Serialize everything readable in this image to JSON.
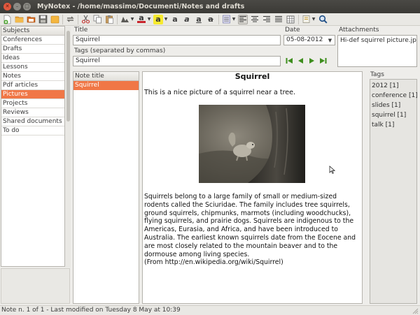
{
  "window": {
    "title": "MyNotex - /home/massimo/Documenti/Notes and drafts"
  },
  "toolbar": {
    "icons": [
      "new-note-icon",
      "new-subject-icon",
      "open-file-icon",
      "save-icon",
      "import-icon",
      "cut-icon",
      "copy-icon",
      "paste-icon",
      "undo-icon",
      "redo-icon",
      "insert-image-icon",
      "font-color-icon",
      "highlight-color-icon",
      "bold-icon",
      "italic-icon",
      "underline-icon",
      "strikethrough-icon",
      "list-icon",
      "align-left-icon",
      "align-center-icon",
      "align-right-icon",
      "justify-icon",
      "insert-table-icon",
      "note-type-icon",
      "search-icon"
    ],
    "font_color_glyph": "a",
    "highlight_glyph": "a",
    "bold_glyph": "a",
    "italic_glyph": "a",
    "underline_glyph": "a",
    "strike_glyph": "a",
    "font_color": "#c8252c",
    "highlight_color": "#f7ea2f"
  },
  "subjects": {
    "header": "Subjects",
    "items": [
      "Conferences",
      "Drafts",
      "Ideas",
      "Lessons",
      "Notes",
      "Pdf articles",
      "Pictures",
      "Projects",
      "Reviews",
      "Shared documents",
      "To do"
    ],
    "selected": "Pictures"
  },
  "note_fields": {
    "title_label": "Title",
    "title_value": "Squirrel",
    "tags_label": "Tags (separated by commas)",
    "tags_value": "Squirrel",
    "date_label": "Date",
    "date_value": "05-08-2012",
    "attachments_label": "Attachments",
    "attachments": [
      "Hi-def squirrel picture.jpg"
    ]
  },
  "note_list": {
    "header": "Note title",
    "items": [
      "Squirrel"
    ]
  },
  "editor": {
    "heading": "Squirrel",
    "intro": "This is a nice picture of a squirrel near a tree.",
    "body": "Squirrels belong to a large family of small or medium-sized rodents called the Sciuridae. The family includes tree squirrels, ground squirrels, chipmunks, marmots (including woodchucks), flying squirrels, and prairie dogs. Squirrels are indigenous to the Americas, Eurasia, and Africa, and have been introduced to Australia. The earliest known squirrels date from the Eocene and are most closely related to the mountain beaver and to the dormouse among living species.",
    "source": "(From http://en.wikipedia.org/wiki/Squirrel)"
  },
  "tags_panel": {
    "label": "Tags",
    "items": [
      "2012 [1]",
      "conference [1]",
      "slides [1]",
      "squirrel [1]",
      "talk [1]"
    ]
  },
  "statusbar": {
    "text": "Note n. 1 of 1 - Last modified on Tuesday 8 May at 10:39"
  },
  "colors": {
    "selection": "#f07746",
    "titlebar": "#3b3a36",
    "nav_arrows": "#3e8e1e"
  }
}
